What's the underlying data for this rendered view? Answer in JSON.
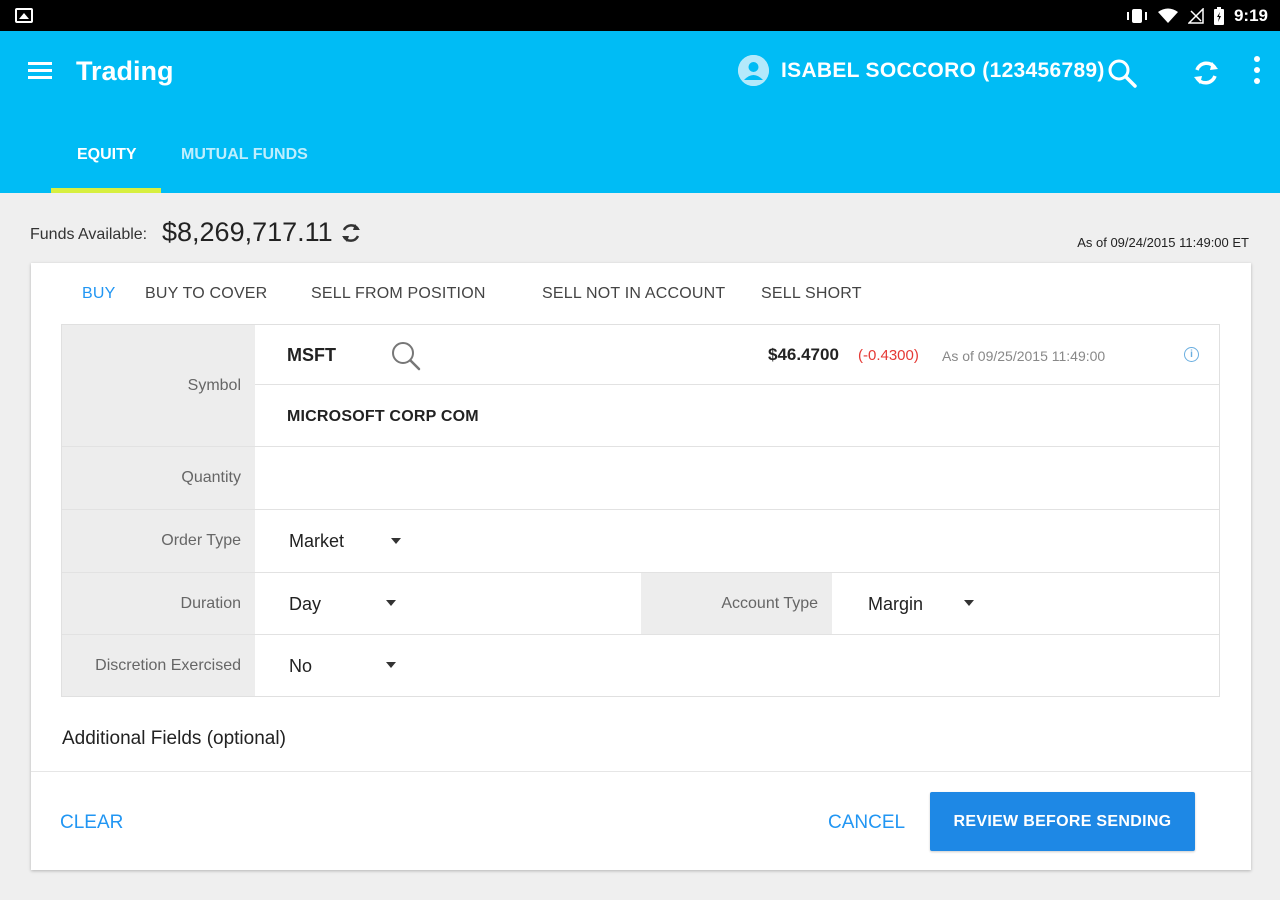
{
  "status_bar": {
    "time": "9:19"
  },
  "app_bar": {
    "title": "Trading",
    "user": "ISABEL SOCCORO (123456789)",
    "tabs": [
      {
        "label": "EQUITY",
        "active": true
      },
      {
        "label": "MUTUAL FUNDS",
        "active": false
      }
    ]
  },
  "funds": {
    "label": "Funds Available:",
    "value": "$8,269,717.11",
    "as_of": "As of 09/24/2015 11:49:00 ET"
  },
  "order_tabs": [
    {
      "label": "BUY",
      "active": true
    },
    {
      "label": "BUY TO COVER",
      "active": false
    },
    {
      "label": "SELL FROM POSITION",
      "active": false
    },
    {
      "label": "SELL NOT IN ACCOUNT",
      "active": false
    },
    {
      "label": "SELL SHORT",
      "active": false
    }
  ],
  "form": {
    "symbol": {
      "label": "Symbol",
      "value": "MSFT",
      "price": "$46.4700",
      "change": "(-0.4300)",
      "as_of": "As of 09/25/2015 11:49:00",
      "company": "MICROSOFT CORP COM"
    },
    "quantity": {
      "label": "Quantity",
      "value": ""
    },
    "order_type": {
      "label": "Order Type",
      "value": "Market"
    },
    "duration": {
      "label": "Duration",
      "value": "Day"
    },
    "account_type": {
      "label": "Account Type",
      "value": "Margin"
    },
    "discretion": {
      "label": "Discretion Exercised",
      "value": "No"
    }
  },
  "additional_fields": "Additional Fields (optional)",
  "actions": {
    "clear": "CLEAR",
    "cancel": "CANCEL",
    "review": "REVIEW BEFORE SENDING"
  },
  "colors": {
    "app_bar": "#00bcf5",
    "tab_indicator": "#d7ef3f",
    "accent": "#2196f3",
    "primary_button": "#1e88e5",
    "negative": "#e53935"
  }
}
